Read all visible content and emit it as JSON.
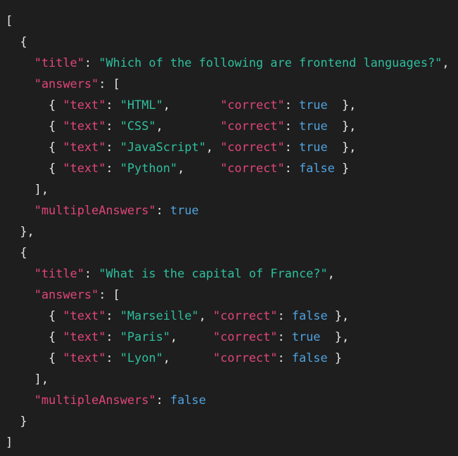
{
  "editor": {
    "lines": [
      [
        {
          "t": "[",
          "c": "punc"
        }
      ],
      [
        {
          "t": "  {",
          "c": "punc"
        }
      ],
      [
        {
          "t": "    ",
          "c": "punc"
        },
        {
          "t": "\"title\"",
          "c": "key"
        },
        {
          "t": ": ",
          "c": "punc"
        },
        {
          "t": "\"Which of the following are frontend languages?\"",
          "c": "str"
        },
        {
          "t": ",",
          "c": "punc"
        }
      ],
      [
        {
          "t": "    ",
          "c": "punc"
        },
        {
          "t": "\"answers\"",
          "c": "key"
        },
        {
          "t": ": [",
          "c": "punc"
        }
      ],
      [
        {
          "t": "      { ",
          "c": "punc"
        },
        {
          "t": "\"text\"",
          "c": "key"
        },
        {
          "t": ": ",
          "c": "punc"
        },
        {
          "t": "\"HTML\"",
          "c": "str"
        },
        {
          "t": ",       ",
          "c": "punc"
        },
        {
          "t": "\"correct\"",
          "c": "key"
        },
        {
          "t": ": ",
          "c": "punc"
        },
        {
          "t": "true",
          "c": "bool"
        },
        {
          "t": "  },",
          "c": "punc"
        }
      ],
      [
        {
          "t": "      { ",
          "c": "punc"
        },
        {
          "t": "\"text\"",
          "c": "key"
        },
        {
          "t": ": ",
          "c": "punc"
        },
        {
          "t": "\"CSS\"",
          "c": "str"
        },
        {
          "t": ",        ",
          "c": "punc"
        },
        {
          "t": "\"correct\"",
          "c": "key"
        },
        {
          "t": ": ",
          "c": "punc"
        },
        {
          "t": "true",
          "c": "bool"
        },
        {
          "t": "  },",
          "c": "punc"
        }
      ],
      [
        {
          "t": "      { ",
          "c": "punc"
        },
        {
          "t": "\"text\"",
          "c": "key"
        },
        {
          "t": ": ",
          "c": "punc"
        },
        {
          "t": "\"JavaScript\"",
          "c": "str"
        },
        {
          "t": ", ",
          "c": "punc"
        },
        {
          "t": "\"correct\"",
          "c": "key"
        },
        {
          "t": ": ",
          "c": "punc"
        },
        {
          "t": "true",
          "c": "bool"
        },
        {
          "t": "  },",
          "c": "punc"
        }
      ],
      [
        {
          "t": "      { ",
          "c": "punc"
        },
        {
          "t": "\"text\"",
          "c": "key"
        },
        {
          "t": ": ",
          "c": "punc"
        },
        {
          "t": "\"Python\"",
          "c": "str"
        },
        {
          "t": ",     ",
          "c": "punc"
        },
        {
          "t": "\"correct\"",
          "c": "key"
        },
        {
          "t": ": ",
          "c": "punc"
        },
        {
          "t": "false",
          "c": "bool"
        },
        {
          "t": " }",
          "c": "punc"
        }
      ],
      [
        {
          "t": "    ],",
          "c": "punc"
        }
      ],
      [
        {
          "t": "    ",
          "c": "punc"
        },
        {
          "t": "\"multipleAnswers\"",
          "c": "key"
        },
        {
          "t": ": ",
          "c": "punc"
        },
        {
          "t": "true",
          "c": "bool"
        }
      ],
      [
        {
          "t": "  },",
          "c": "punc"
        }
      ],
      [
        {
          "t": "  {",
          "c": "punc"
        }
      ],
      [
        {
          "t": "    ",
          "c": "punc"
        },
        {
          "t": "\"title\"",
          "c": "key"
        },
        {
          "t": ": ",
          "c": "punc"
        },
        {
          "t": "\"What is the capital of France?\"",
          "c": "str"
        },
        {
          "t": ",",
          "c": "punc"
        }
      ],
      [
        {
          "t": "    ",
          "c": "punc"
        },
        {
          "t": "\"answers\"",
          "c": "key"
        },
        {
          "t": ": [",
          "c": "punc"
        }
      ],
      [
        {
          "t": "      { ",
          "c": "punc"
        },
        {
          "t": "\"text\"",
          "c": "key"
        },
        {
          "t": ": ",
          "c": "punc"
        },
        {
          "t": "\"Marseille\"",
          "c": "str"
        },
        {
          "t": ", ",
          "c": "punc"
        },
        {
          "t": "\"correct\"",
          "c": "key"
        },
        {
          "t": ": ",
          "c": "punc"
        },
        {
          "t": "false",
          "c": "bool"
        },
        {
          "t": " },",
          "c": "punc"
        }
      ],
      [
        {
          "t": "      { ",
          "c": "punc"
        },
        {
          "t": "\"text\"",
          "c": "key"
        },
        {
          "t": ": ",
          "c": "punc"
        },
        {
          "t": "\"Paris\"",
          "c": "str"
        },
        {
          "t": ",     ",
          "c": "punc"
        },
        {
          "t": "\"correct\"",
          "c": "key"
        },
        {
          "t": ": ",
          "c": "punc"
        },
        {
          "t": "true",
          "c": "bool"
        },
        {
          "t": "  },",
          "c": "punc"
        }
      ],
      [
        {
          "t": "      { ",
          "c": "punc"
        },
        {
          "t": "\"text\"",
          "c": "key"
        },
        {
          "t": ": ",
          "c": "punc"
        },
        {
          "t": "\"Lyon\"",
          "c": "str"
        },
        {
          "t": ",      ",
          "c": "punc"
        },
        {
          "t": "\"correct\"",
          "c": "key"
        },
        {
          "t": ": ",
          "c": "punc"
        },
        {
          "t": "false",
          "c": "bool"
        },
        {
          "t": " }",
          "c": "punc"
        }
      ],
      [
        {
          "t": "    ],",
          "c": "punc"
        }
      ],
      [
        {
          "t": "    ",
          "c": "punc"
        },
        {
          "t": "\"multipleAnswers\"",
          "c": "key"
        },
        {
          "t": ": ",
          "c": "punc"
        },
        {
          "t": "false",
          "c": "bool"
        }
      ],
      [
        {
          "t": "  }",
          "c": "punc"
        }
      ],
      [
        {
          "t": "]",
          "c": "punc"
        }
      ]
    ],
    "colors": {
      "background": "#1e1e1e",
      "key": "#e0457b",
      "string": "#2fbf9e",
      "boolean": "#4fa3e0",
      "punctuation": "#e6e6e6"
    }
  }
}
